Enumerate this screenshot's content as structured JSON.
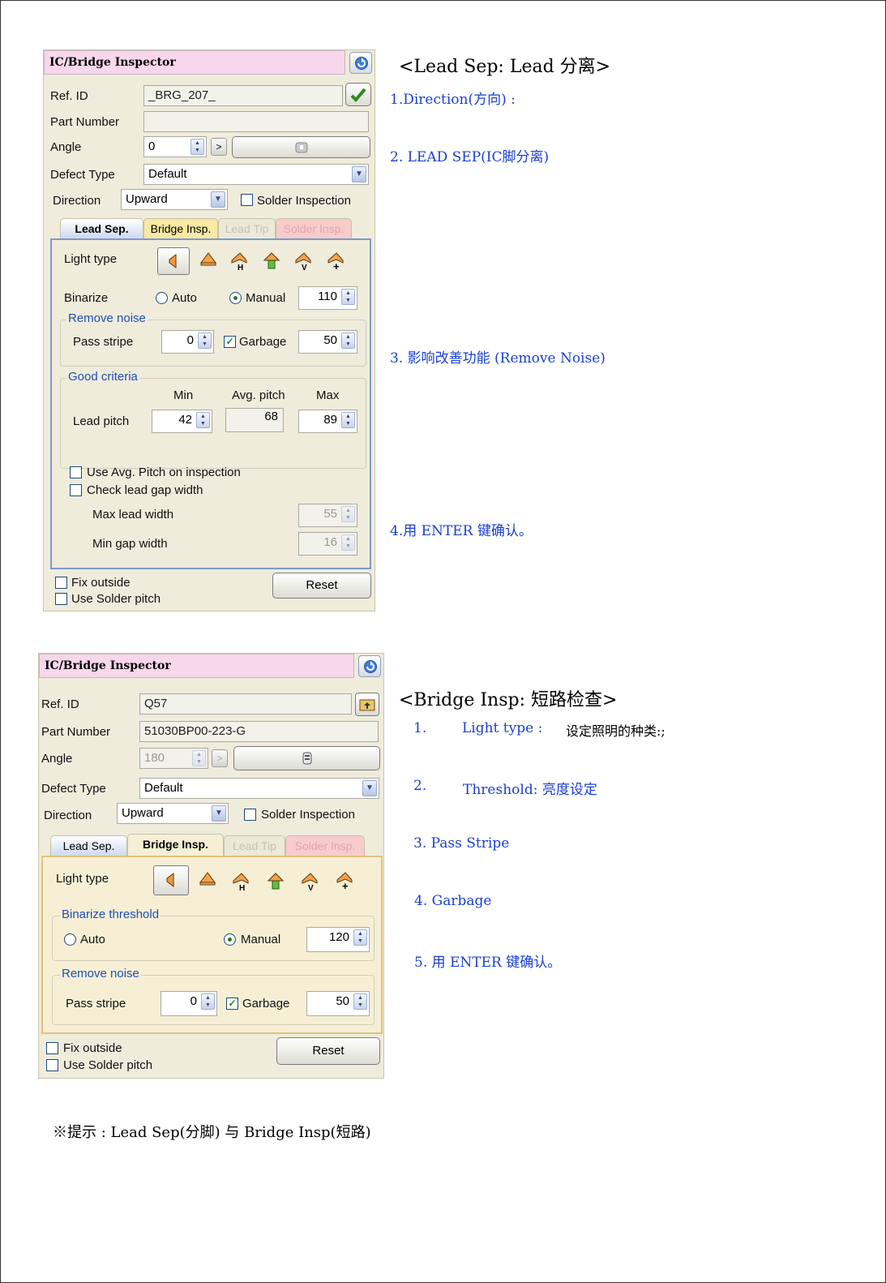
{
  "panel1": {
    "title": "IC/Bridge Inspector",
    "ref_id_label": "Ref. ID",
    "ref_id_value": "_BRG_207_",
    "part_number_label": "Part Number",
    "part_number_value": "",
    "angle_label": "Angle",
    "angle_value": "0",
    "arrow_label": ">",
    "defect_type_label": "Defect Type",
    "defect_type_value": "Default",
    "direction_label": "Direction",
    "direction_value": "Upward",
    "solder_inspection_label": "Solder Inspection",
    "tabs": [
      "Lead Sep.",
      "Bridge Insp.",
      "Lead Tip",
      "Solder Insp."
    ],
    "light_type_label": "Light type",
    "binarize_label": "Binarize",
    "auto_label": "Auto",
    "manual_label": "Manual",
    "binarize_value": "110",
    "remove_noise_label": "Remove noise",
    "pass_stripe_label": "Pass stripe",
    "pass_stripe_value": "0",
    "garbage_label": "Garbage",
    "garbage_value": "50",
    "good_criteria_label": "Good criteria",
    "min_label": "Min",
    "avg_pitch_label": "Avg. pitch",
    "max_label": "Max",
    "lead_pitch_label": "Lead pitch",
    "lead_pitch_min": "42",
    "lead_pitch_avg": "68",
    "lead_pitch_max": "89",
    "use_avg_pitch_label": "Use Avg. Pitch on inspection",
    "check_lead_gap_label": "Check lead  gap width",
    "max_lead_width_label": "Max lead width",
    "max_lead_width_value": "55",
    "min_gap_width_label": "Min gap width",
    "min_gap_width_value": "16",
    "fix_outside_label": "Fix outside",
    "use_solder_pitch_label": "Use Solder pitch",
    "reset_label": "Reset"
  },
  "panel2": {
    "title": "IC/Bridge Inspector",
    "ref_id_label": "Ref. ID",
    "ref_id_value": "Q57",
    "part_number_label": "Part Number",
    "part_number_value": "51030BP00-223-G",
    "angle_label": "Angle",
    "angle_value": "180",
    "arrow_label": ">",
    "defect_type_label": "Defect Type",
    "defect_type_value": "Default",
    "direction_label": "Direction",
    "direction_value": "Upward",
    "solder_inspection_label": "Solder Inspection",
    "tabs": [
      "Lead Sep.",
      "Bridge Insp.",
      "Lead Tip",
      "Solder Insp."
    ],
    "light_type_label": "Light type",
    "binarize_threshold_label": "Binarize threshold",
    "auto_label": "Auto",
    "manual_label": "Manual",
    "binarize_value": "120",
    "remove_noise_label": "Remove noise",
    "pass_stripe_label": "Pass stripe",
    "pass_stripe_value": "0",
    "garbage_label": "Garbage",
    "garbage_value": "50",
    "fix_outside_label": "Fix outside",
    "use_solder_pitch_label": "Use Solder pitch",
    "reset_label": "Reset"
  },
  "notes1": {
    "heading": "<Lead Sep: Lead 分离>",
    "items": [
      "1.Direction(方向) :",
      "2. LEAD SEP(IC脚分离)",
      "3. 影响改善功能 (Remove Noise)",
      "4.用 ENTER 键确认。"
    ]
  },
  "notes2": {
    "heading": "<Bridge Insp: 短路检查>",
    "item1_num": "1.",
    "item1_text": "Light type :",
    "item1_black": "设定照明的种类:;",
    "item2_num": "2.",
    "item2_text": "Threshold: 亮度设定",
    "item3": "3.  Pass Stripe",
    "item4": "4. Garbage",
    "item5": "5. 用 ENTER 键确认。"
  },
  "footer_note": "※提示 : Lead Sep(分脚) 与 Bridge Insp(短路)",
  "icons": [
    "refresh-icon",
    "checkmark-icon",
    "camera-icon",
    "folder-up-icon",
    "light-side-icon",
    "light-top-icon",
    "light-h-icon",
    "light-green-icon",
    "light-v-icon",
    "light-plus-icon"
  ]
}
